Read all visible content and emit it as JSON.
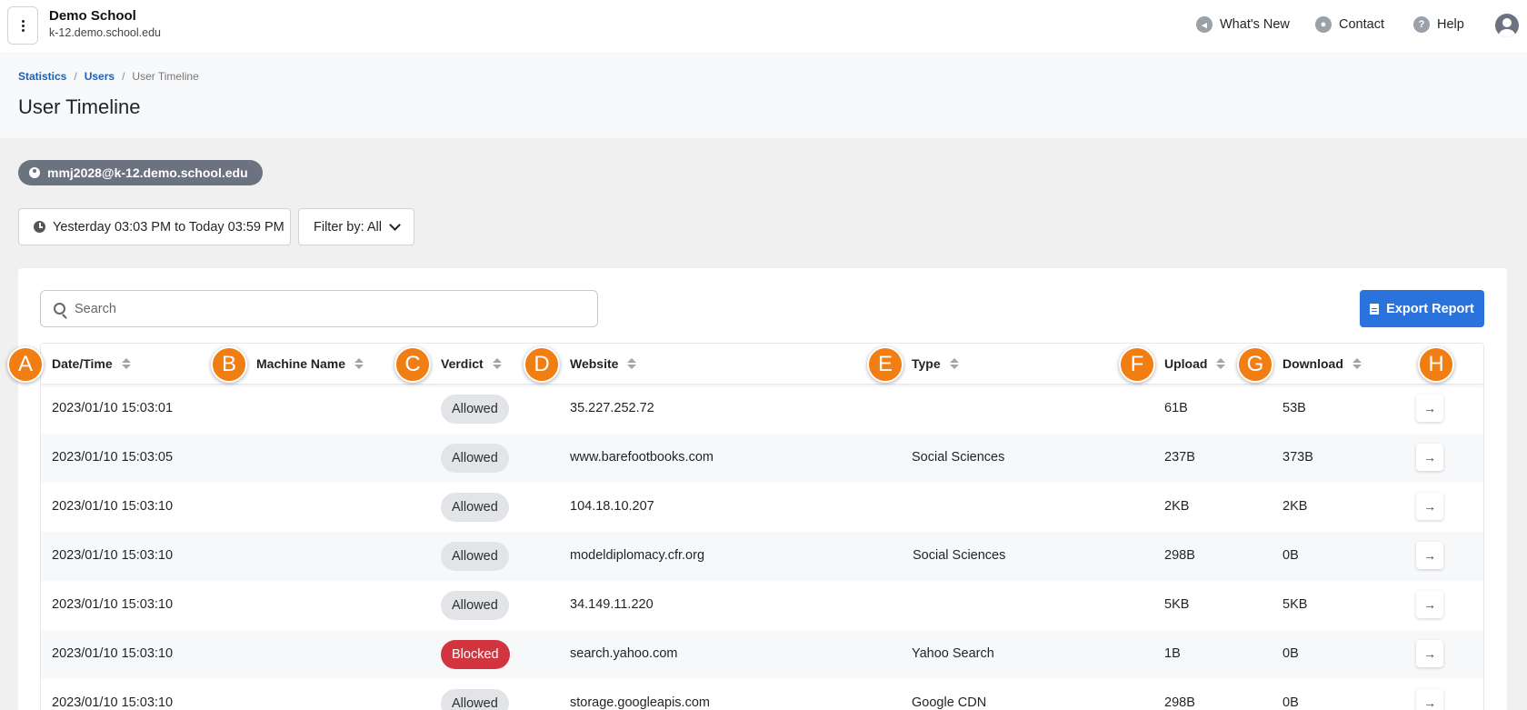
{
  "topbar": {
    "org_name": "Demo School",
    "org_domain": "k-12.demo.school.edu",
    "whats_new": "What's New",
    "contact": "Contact",
    "help": "Help"
  },
  "breadcrumb": {
    "statistics": "Statistics",
    "users": "Users",
    "current": "User Timeline"
  },
  "page_title": "User Timeline",
  "user_chip": "mmj2028@k-12.demo.school.edu",
  "filters": {
    "date_range": "Yesterday 03:03 PM to Today 03:59 PM",
    "filter_by": "Filter by: All"
  },
  "search": {
    "placeholder": "Search"
  },
  "export_label": "Export Report",
  "columns": {
    "datetime": "Date/Time",
    "machine": "Machine Name",
    "verdict": "Verdict",
    "website": "Website",
    "type": "Type",
    "upload": "Upload",
    "download": "Download"
  },
  "markers": [
    "A",
    "B",
    "C",
    "D",
    "E",
    "F",
    "G",
    "H"
  ],
  "rows": [
    {
      "datetime": "2023/01/10 15:03:01",
      "machine": "",
      "verdict": "Allowed",
      "website": "35.227.252.72",
      "type": "",
      "upload": "61B",
      "download": "53B"
    },
    {
      "datetime": "2023/01/10 15:03:05",
      "machine": "",
      "verdict": "Allowed",
      "website": "www.barefootbooks.com",
      "type": "Social Sciences",
      "upload": "237B",
      "download": "373B"
    },
    {
      "datetime": "2023/01/10 15:03:10",
      "machine": "",
      "verdict": "Allowed",
      "website": "104.18.10.207",
      "type": "",
      "upload": "2KB",
      "download": "2KB"
    },
    {
      "datetime": "2023/01/10 15:03:10",
      "machine": "",
      "verdict": "Allowed",
      "website": "modeldiplomacy.cfr.org",
      "type": "Social Sciences",
      "upload": "298B",
      "download": "0B"
    },
    {
      "datetime": "2023/01/10 15:03:10",
      "machine": "",
      "verdict": "Allowed",
      "website": "34.149.11.220",
      "type": "",
      "upload": "5KB",
      "download": "5KB"
    },
    {
      "datetime": "2023/01/10 15:03:10",
      "machine": "",
      "verdict": "Blocked",
      "website": "search.yahoo.com",
      "type": "Yahoo Search",
      "upload": "1B",
      "download": "0B"
    },
    {
      "datetime": "2023/01/10 15:03:10",
      "machine": "",
      "verdict": "Allowed",
      "website": "storage.googleapis.com",
      "type": "Google CDN",
      "upload": "298B",
      "download": "0B"
    }
  ],
  "colors": {
    "accent": "#2b73dc",
    "blocked": "#d2353f",
    "marker": "#f07e12",
    "breadcrumb_link": "#1d5fb3"
  }
}
